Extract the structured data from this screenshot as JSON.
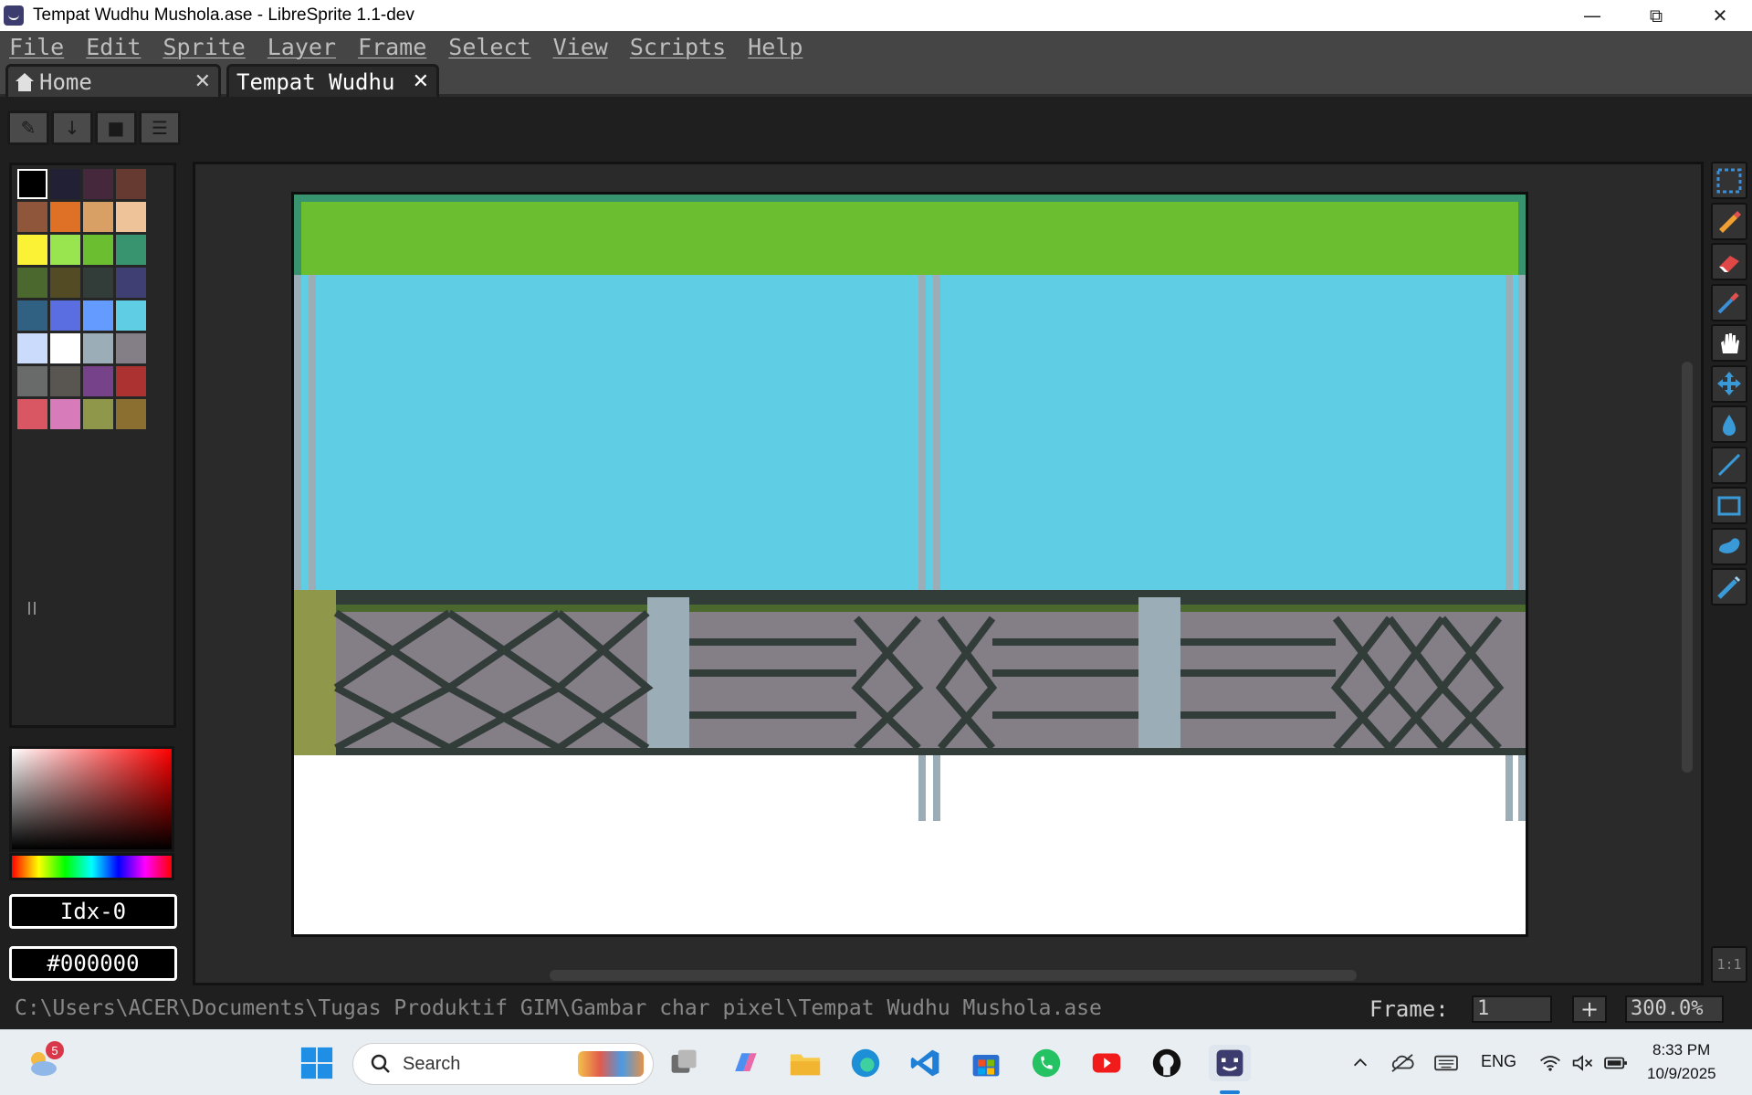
{
  "window": {
    "title": "Tempat Wudhu Mushola.ase - LibreSprite 1.1-dev",
    "controls": [
      "minimize",
      "restore",
      "close"
    ]
  },
  "menu": [
    "File",
    "Edit",
    "Sprite",
    "Layer",
    "Frame",
    "Select",
    "View",
    "Scripts",
    "Help"
  ],
  "tabs": [
    {
      "label": "Home",
      "icon": "home-icon",
      "active": false
    },
    {
      "label": "Tempat Wudhu",
      "active": true
    }
  ],
  "palette": {
    "colors": [
      "#000000",
      "#222034",
      "#45283c",
      "#663931",
      "#8f563b",
      "#df7126",
      "#d9a066",
      "#eec39a",
      "#fbf236",
      "#99e550",
      "#6abe30",
      "#37946e",
      "#4b692f",
      "#524b24",
      "#323c39",
      "#3f3f74",
      "#306082",
      "#5b6ee1",
      "#639bff",
      "#5fcde4",
      "#cbdbfc",
      "#ffffff",
      "#9badb7",
      "#847e87",
      "#696a6a",
      "#595652",
      "#76428a",
      "#ac3232",
      "#d95763",
      "#d77bba",
      "#8f974a",
      "#8a6f30"
    ]
  },
  "color_picker": {
    "index_label": "Idx-0",
    "hex_label": "#000000"
  },
  "sprite_colors": {
    "roof": "#6abe30",
    "sky": "#5fcde4",
    "fence": "#847e87",
    "fence_dark": "#323c39",
    "post": "#9badb7",
    "rail": "#4b692f",
    "wall": "#8f974a",
    "floor": "#ffffff"
  },
  "tools": [
    "marquee-icon",
    "pencil-icon",
    "eraser-icon",
    "eyedropper-icon",
    "hand-icon",
    "move-icon",
    "paint-bucket-icon",
    "line-icon",
    "rectangle-icon",
    "contour-icon",
    "blur-icon"
  ],
  "zoom_reset_label": "1:1",
  "status": {
    "path": "C:\\Users\\ACER\\Documents\\Tugas Produktif GIM\\Gambar char pixel\\Tempat Wudhu Mushola.ase",
    "frame_label": "Frame:",
    "frame_value": "1",
    "add_label": "+",
    "zoom": "300.0%"
  },
  "taskbar": {
    "weather_badge": "5",
    "search_label": "Search",
    "lang": "ENG",
    "time": "8:33 PM",
    "date": "10/9/2025"
  }
}
